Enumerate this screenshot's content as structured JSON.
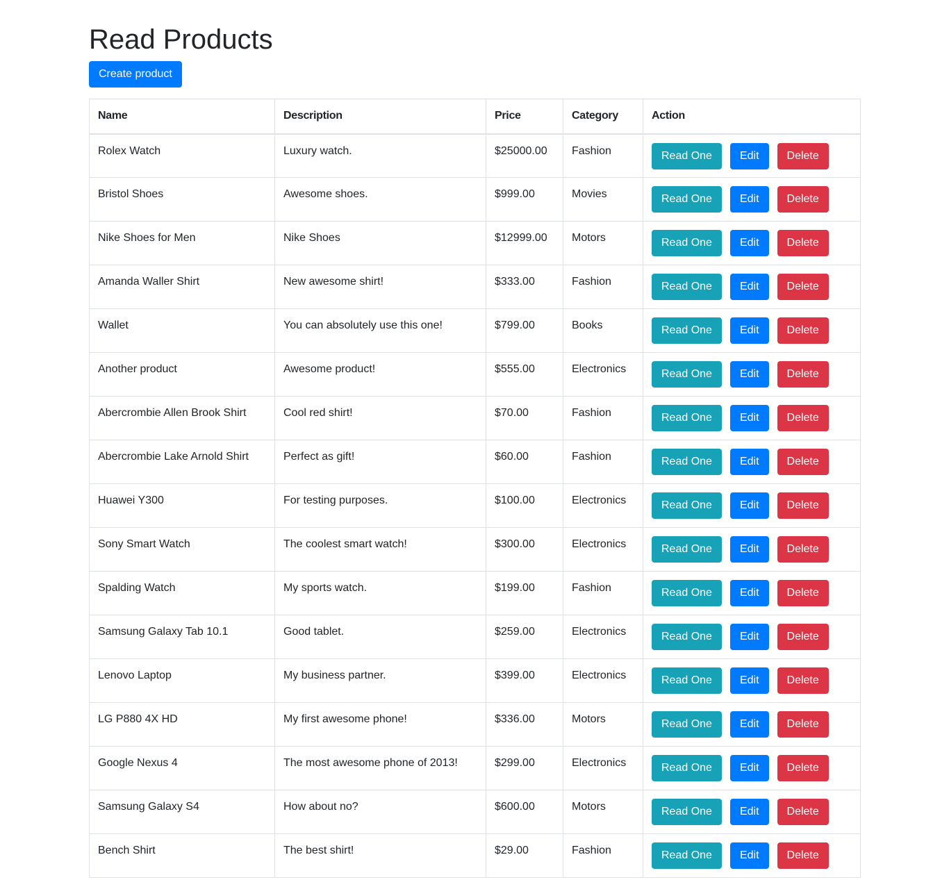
{
  "page": {
    "title": "Read Products",
    "create_button_label": "Create product"
  },
  "colors": {
    "primary": "#007bff",
    "info": "#17a2b8",
    "danger": "#dc3545",
    "border": "#dee2e6",
    "text": "#212529"
  },
  "table": {
    "headers": {
      "name": "Name",
      "description": "Description",
      "price": "Price",
      "category": "Category",
      "action": "Action"
    },
    "action_labels": {
      "read": "Read One",
      "edit": "Edit",
      "delete": "Delete"
    },
    "rows": [
      {
        "name": "Rolex Watch",
        "description": "Luxury watch.",
        "price": "$25000.00",
        "category": "Fashion"
      },
      {
        "name": "Bristol Shoes",
        "description": "Awesome shoes.",
        "price": "$999.00",
        "category": "Movies"
      },
      {
        "name": "Nike Shoes for Men",
        "description": "Nike Shoes",
        "price": "$12999.00",
        "category": "Motors"
      },
      {
        "name": "Amanda Waller Shirt",
        "description": "New awesome shirt!",
        "price": "$333.00",
        "category": "Fashion"
      },
      {
        "name": "Wallet",
        "description": "You can absolutely use this one!",
        "price": "$799.00",
        "category": "Books"
      },
      {
        "name": "Another product",
        "description": "Awesome product!",
        "price": "$555.00",
        "category": "Electronics"
      },
      {
        "name": "Abercrombie Allen Brook Shirt",
        "description": "Cool red shirt!",
        "price": "$70.00",
        "category": "Fashion"
      },
      {
        "name": "Abercrombie Lake Arnold Shirt",
        "description": "Perfect as gift!",
        "price": "$60.00",
        "category": "Fashion"
      },
      {
        "name": "Huawei Y300",
        "description": "For testing purposes.",
        "price": "$100.00",
        "category": "Electronics"
      },
      {
        "name": "Sony Smart Watch",
        "description": "The coolest smart watch!",
        "price": "$300.00",
        "category": "Electronics"
      },
      {
        "name": "Spalding Watch",
        "description": "My sports watch.",
        "price": "$199.00",
        "category": "Fashion"
      },
      {
        "name": "Samsung Galaxy Tab 10.1",
        "description": "Good tablet.",
        "price": "$259.00",
        "category": "Electronics"
      },
      {
        "name": "Lenovo Laptop",
        "description": "My business partner.",
        "price": "$399.00",
        "category": "Electronics"
      },
      {
        "name": "LG P880 4X HD",
        "description": "My first awesome phone!",
        "price": "$336.00",
        "category": "Motors"
      },
      {
        "name": "Google Nexus 4",
        "description": "The most awesome phone of 2013!",
        "price": "$299.00",
        "category": "Electronics"
      },
      {
        "name": "Samsung Galaxy S4",
        "description": "How about no?",
        "price": "$600.00",
        "category": "Motors"
      },
      {
        "name": "Bench Shirt",
        "description": "The best shirt!",
        "price": "$29.00",
        "category": "Fashion"
      }
    ]
  }
}
